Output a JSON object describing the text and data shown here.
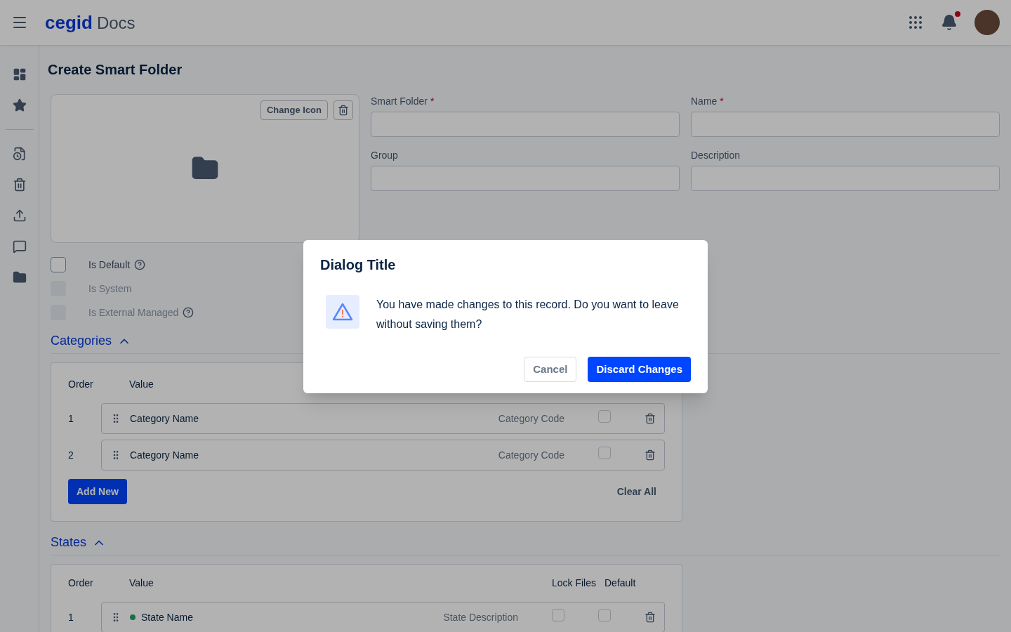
{
  "header": {
    "logo_brand": "cegid",
    "logo_product": "Docs",
    "notification_dot": true
  },
  "page": {
    "title": "Create Smart Folder"
  },
  "icon_card": {
    "change_button": "Change Icon"
  },
  "fields": [
    {
      "label": "Smart Folder",
      "required_mark": "*"
    },
    {
      "label": "Name",
      "required_mark": "*"
    },
    {
      "label": "Group"
    },
    {
      "label": "Description"
    }
  ],
  "flags": [
    {
      "label": "Is Default",
      "checked": false,
      "disabled": false,
      "help": true
    },
    {
      "label": "Is System",
      "checked": false,
      "disabled": true,
      "help": false
    },
    {
      "label": "Is External Managed",
      "checked": false,
      "disabled": true,
      "help": true
    }
  ],
  "categories": {
    "title": "Categories",
    "expanded": true,
    "columns": [
      "Order",
      "Value"
    ],
    "rows": [
      {
        "order": "1",
        "name": "Category Name",
        "code": "Category Code",
        "default": false
      },
      {
        "order": "2",
        "name": "Category Name",
        "code": "Category Code",
        "default": false
      }
    ],
    "add_button": "Add New",
    "clear_button": "Clear All"
  },
  "states": {
    "title": "States",
    "expanded": true,
    "columns": [
      "Order",
      "Value",
      "Lock Files",
      "Default"
    ],
    "rows": [
      {
        "order": "1",
        "name": "State Name",
        "color": "#18704b",
        "description": "State Description",
        "lock_files": false,
        "default": false
      }
    ]
  },
  "dialog": {
    "title": "Dialog Title",
    "message": "You have made changes to this record. Do you want to leave without saving them?",
    "cancel": "Cancel",
    "confirm": "Discard Changes"
  }
}
